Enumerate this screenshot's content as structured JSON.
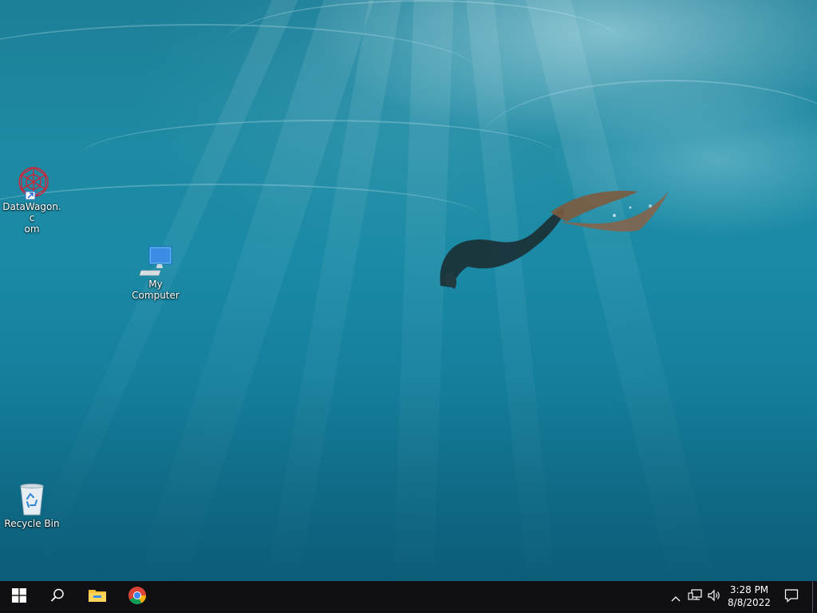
{
  "desktop": {
    "icons": [
      {
        "label": "DataWagon.com",
        "label_line1": "DataWagon.c",
        "label_line2": "om",
        "icon": "datawagon-shortcut-icon"
      },
      {
        "label": "My Computer",
        "icon": "computer-monitor-icon"
      },
      {
        "label": "Recycle Bin",
        "icon": "recycle-bin-icon"
      }
    ]
  },
  "taskbar": {
    "start_icon": "windows-logo-icon",
    "search_icon": "search-icon",
    "pinned": [
      "file-explorer-icon",
      "chrome-icon"
    ],
    "tray": {
      "chevron_icon": "chevron-up-icon",
      "network_icon": "network-icon",
      "volume_icon": "volume-icon",
      "notification_icon": "notification-icon"
    },
    "clock": {
      "time": "3:28 PM",
      "date": "8/8/2022"
    }
  },
  "colors": {
    "taskbar_bg": "#101014",
    "water_top": "#1d7f98",
    "water_bottom": "#0c5c77",
    "accent_blue": "#3c8ce6"
  }
}
